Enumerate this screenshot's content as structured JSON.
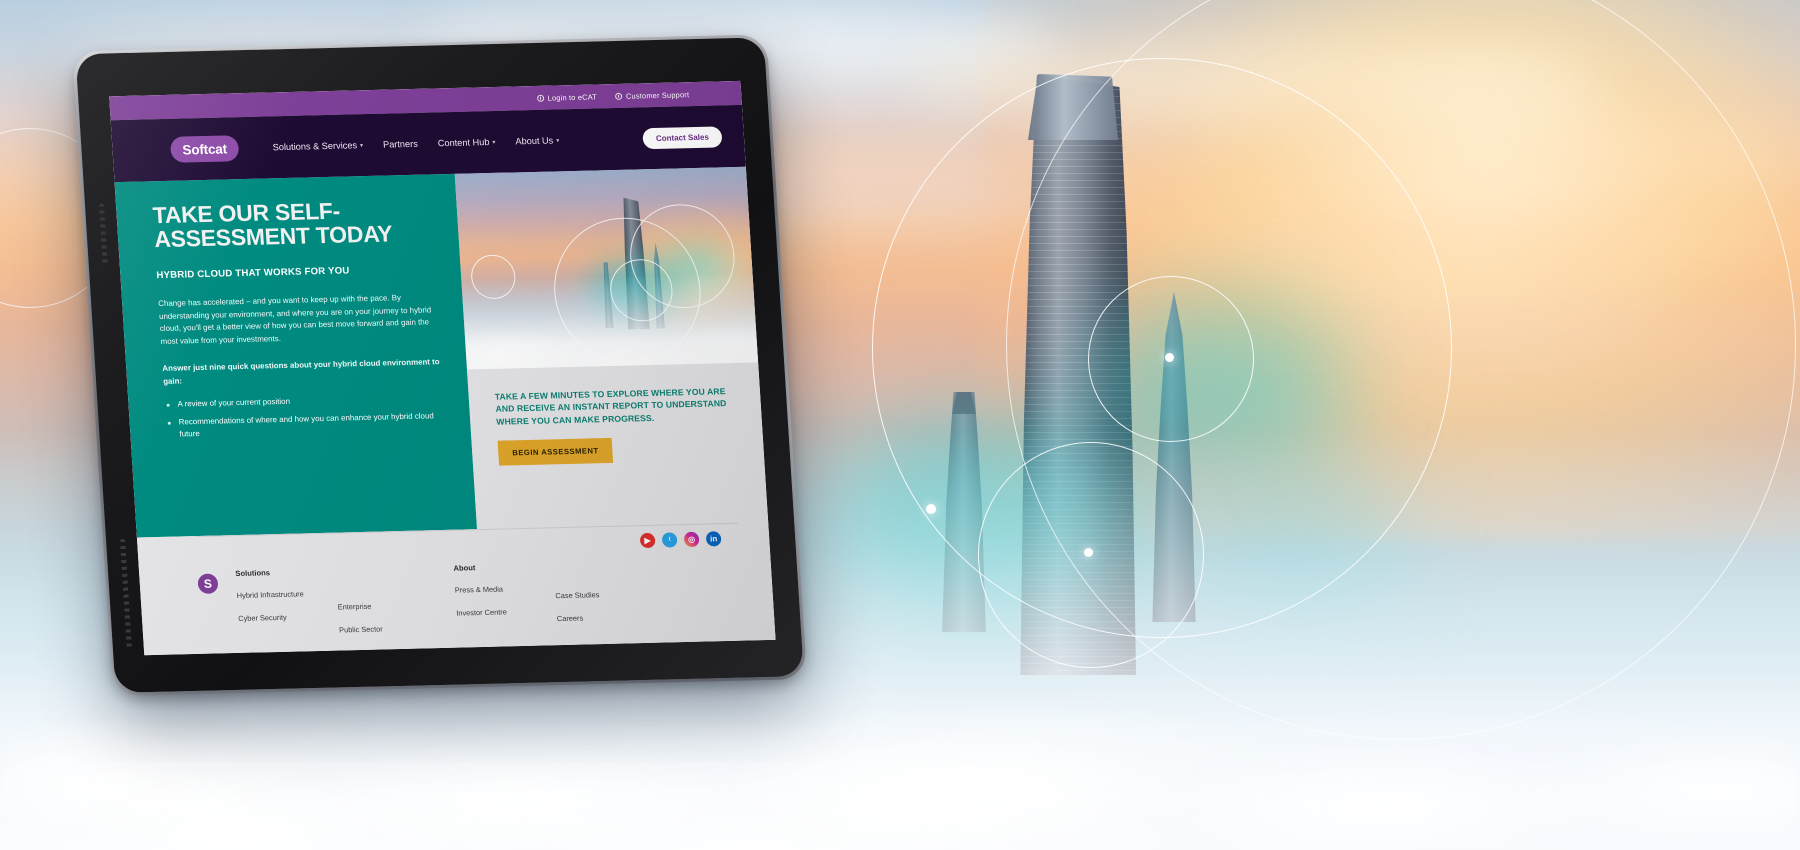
{
  "background": {
    "scene_description": "Sunset above a sea of clouds with skyscraper tops emerging",
    "decor_icon": "concentric-rings-motif"
  },
  "device": {
    "type": "tablet-mockup"
  },
  "site": {
    "utility_bar": {
      "links": [
        {
          "icon": "clock-icon",
          "label": "Login to eCAT"
        },
        {
          "icon": "clock-icon",
          "label": "Customer Support"
        }
      ]
    },
    "nav": {
      "logo": "Softcat",
      "links": [
        {
          "label": "Solutions & Services",
          "caret": true
        },
        {
          "label": "Partners",
          "caret": false
        },
        {
          "label": "Content Hub",
          "caret": true
        },
        {
          "label": "About Us",
          "caret": true
        }
      ],
      "cta": "Contact Sales"
    },
    "hero": {
      "heading": "TAKE OUR SELF-ASSESSMENT TODAY",
      "kicker": "HYBRID CLOUD THAT WORKS FOR YOU",
      "paragraph": "Change has accelerated – and you want to keep up with the pace. By understanding your environment, and where you are on your journey to hybrid cloud, you'll get a better view of how you can best move forward and gain the most value from your investments.",
      "lead_in": "Answer just nine quick questions about your hybrid cloud environment to gain:",
      "bullets": [
        "A review of your current position",
        "Recommendations of where and how you can enhance your hybrid cloud future"
      ]
    },
    "cta_card": {
      "text": "TAKE A FEW MINUTES TO EXPLORE WHERE YOU ARE AND RECEIVE AN INSTANT REPORT TO UNDERSTAND WHERE YOU CAN MAKE PROGRESS.",
      "button": "BEGIN ASSESSMENT"
    },
    "footer": {
      "brand_mark": "S",
      "socials": [
        {
          "name": "youtube-icon",
          "glyph": "▶"
        },
        {
          "name": "twitter-icon",
          "glyph": "ᵗ"
        },
        {
          "name": "instagram-icon",
          "glyph": "◎"
        },
        {
          "name": "linkedin-icon",
          "glyph": "in"
        }
      ],
      "columns": [
        {
          "title": "Solutions",
          "title_hidden": false,
          "links": [
            "Hybrid Infrastructure",
            "Cyber Security"
          ]
        },
        {
          "title": "",
          "title_hidden": true,
          "links": [
            "Enterprise",
            "Public Sector"
          ]
        },
        {
          "title": "About",
          "title_hidden": false,
          "links": [
            "Press & Media",
            "Investor Centre"
          ]
        },
        {
          "title": "",
          "title_hidden": true,
          "links": [
            "Case Studies",
            "Careers"
          ]
        }
      ]
    }
  },
  "colors": {
    "purple_utility": "#7e3f98",
    "purple_nav": "#1e0b33",
    "teal": "#008b80",
    "amber": "#e0a62a",
    "card_grey": "#e4e4e7"
  }
}
